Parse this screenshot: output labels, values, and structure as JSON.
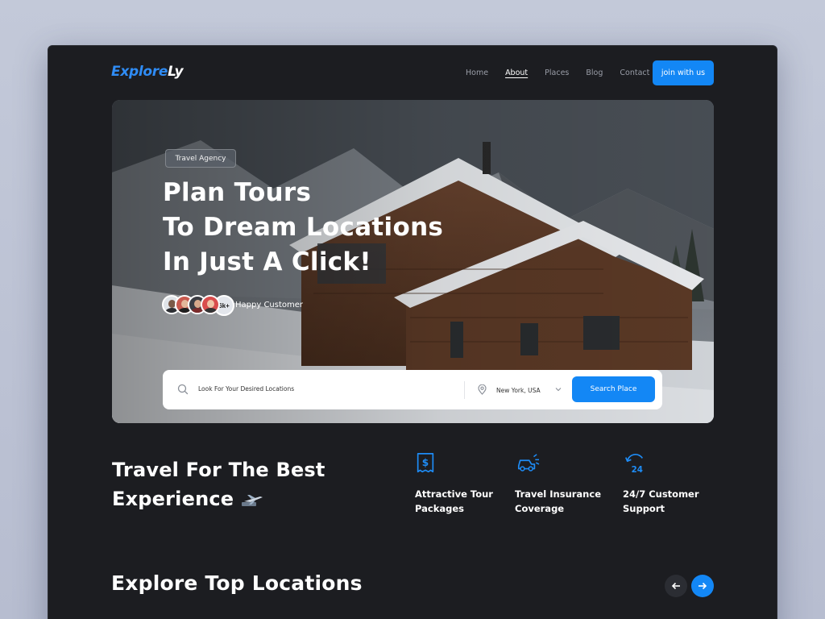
{
  "brand": {
    "logo_part1": "Explore",
    "logo_part2": "Ly"
  },
  "nav": {
    "items": [
      {
        "label": "Home",
        "active": false
      },
      {
        "label": "About",
        "active": true
      },
      {
        "label": "Places",
        "active": false
      },
      {
        "label": "Blog",
        "active": false
      },
      {
        "label": "Contact",
        "active": false
      }
    ],
    "cta_label": "join with us"
  },
  "hero": {
    "badge": "Travel Agency",
    "headline": [
      "Plan Tours",
      "To Dream Locations",
      "In Just A Click!"
    ],
    "customer_count": "6k+",
    "customer_label": "Happy Customer",
    "search": {
      "placeholder": "Look For Your Desired Locations",
      "location": "New York, USA",
      "button_label": "Search Place"
    }
  },
  "experience": {
    "title_line1": "Travel For The Best",
    "title_line2": "Experience",
    "features": [
      {
        "icon": "receipt-dollar-icon",
        "line1": "Attractive Tour",
        "line2": "Packages"
      },
      {
        "icon": "fast-car-icon",
        "line1": "Travel Insurance",
        "line2": "Coverage"
      },
      {
        "icon": "24-hours-icon",
        "line1": "24/7 Customer",
        "line2": "Support"
      }
    ]
  },
  "locations": {
    "title": "Explore Top Locations",
    "prev_icon": "arrow-left-icon",
    "next_icon": "arrow-right-icon"
  },
  "colors": {
    "accent": "#1387f5",
    "background": "#1c1d21",
    "page": "#c3c9d9"
  }
}
